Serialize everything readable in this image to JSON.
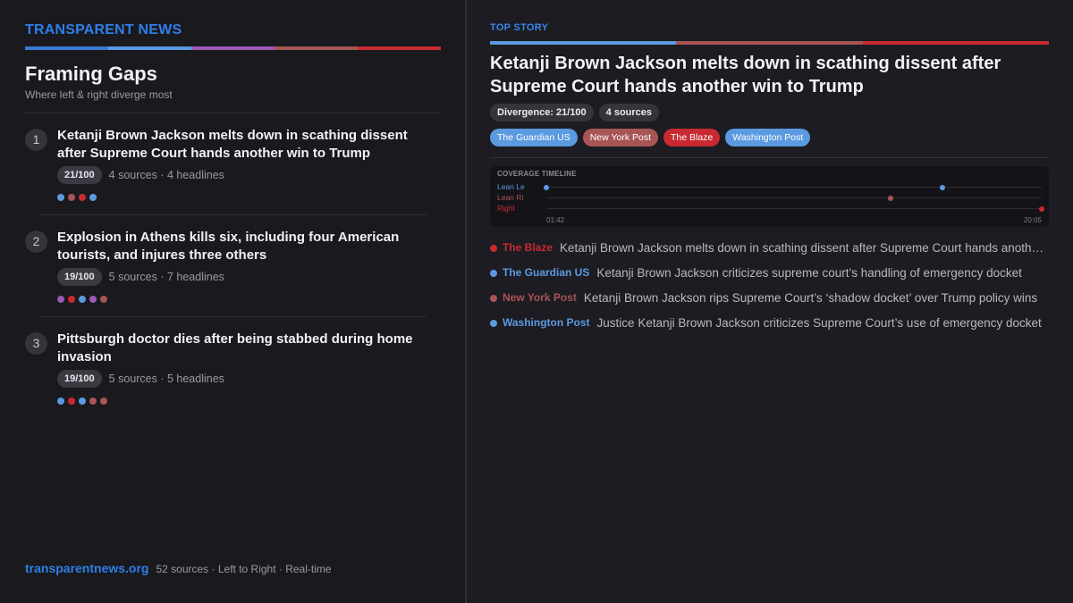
{
  "brand": "TRANSPARENT NEWS",
  "spectrum_colors": [
    "#3a7bd5",
    "#5b9ae0",
    "#9b59b6",
    "#a85555",
    "#c82a30"
  ],
  "sidebar": {
    "title": "Framing Gaps",
    "subtitle": "Where left & right diverge most",
    "stories": [
      {
        "rank": "1",
        "headline": "Ketanji Brown Jackson melts down in scathing dissent after Supreme Court hands another win to Trump",
        "score": "21/100",
        "meta": "4 sources · 4 headlines",
        "dots": [
          "#5b9ae0",
          "#a85555",
          "#c82a30",
          "#5b9ae0"
        ]
      },
      {
        "rank": "2",
        "headline": "Explosion in Athens kills six, including four American tourists, and injures three others",
        "score": "19/100",
        "meta": "5 sources · 7 headlines",
        "dots": [
          "#9b59b6",
          "#c82a30",
          "#5b9ae0",
          "#9b59b6",
          "#a85555"
        ]
      },
      {
        "rank": "3",
        "headline": "Pittsburgh doctor dies after being stabbed during home invasion",
        "score": "19/100",
        "meta": "5 sources · 5 headlines",
        "dots": [
          "#5b9ae0",
          "#c82a30",
          "#5b9ae0",
          "#a85555",
          "#a85555"
        ]
      }
    ]
  },
  "footer": {
    "url": "transparentnews.org",
    "meta": "52 sources · Left to Right · Real-time"
  },
  "top_story": {
    "label": "TOP STORY",
    "spectrum_colors": [
      "#5b9ae0",
      "#a85555",
      "#c82a30"
    ],
    "headline": "Ketanji Brown Jackson melts down in scathing dissent after Supreme Court hands another win to Trump",
    "divergence": "Divergence: 21/100",
    "source_count": "4 sources",
    "sources": [
      {
        "name": "The Guardian US",
        "color": "#5b9ae0"
      },
      {
        "name": "New York Post",
        "color": "#a85555"
      },
      {
        "name": "The Blaze",
        "color": "#c82a30"
      },
      {
        "name": "Washington Post",
        "color": "#5b9ae0"
      }
    ],
    "timeline": {
      "title": "COVERAGE TIMELINE",
      "lanes": [
        {
          "label": "Lean Le",
          "color": "#5b9ae0",
          "points": [
            0.0,
            0.8
          ]
        },
        {
          "label": "Lean Ri",
          "color": "#a85555",
          "points": [
            0.695
          ]
        },
        {
          "label": "Right",
          "color": "#c82a30",
          "points": [
            1.0
          ]
        }
      ],
      "start_time": "01:42",
      "end_time": "20:05"
    },
    "headlines": [
      {
        "source": "The Blaze",
        "color": "#c82a30",
        "text": "Ketanji Brown Jackson melts down in scathing dissent after Supreme Court hands another win to Trump"
      },
      {
        "source": "The Guardian US",
        "color": "#5b9ae0",
        "text": "Ketanji Brown Jackson criticizes supreme court’s handling of emergency docket"
      },
      {
        "source": "New York Post",
        "color": "#a85555",
        "text": "Ketanji Brown Jackson rips Supreme Court’s ‘shadow docket’ over Trump policy wins"
      },
      {
        "source": "Washington Post",
        "color": "#5b9ae0",
        "text": "Justice Ketanji Brown Jackson criticizes Supreme Court’s use of emergency docket"
      }
    ]
  }
}
